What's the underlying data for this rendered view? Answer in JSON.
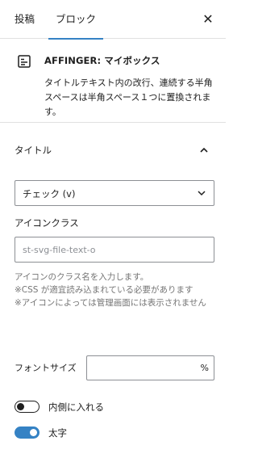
{
  "tabs": [
    {
      "label": "投稿",
      "active": false
    },
    {
      "label": "ブロック",
      "active": true
    }
  ],
  "block": {
    "icon": "card-icon",
    "title": "AFFINGER: マイボックス",
    "description": "タイトルテキスト内の改行、連続する半角スペースは半角スペース１つに置換されます。"
  },
  "panel": {
    "title": "タイトル",
    "expanded": true
  },
  "title_select": {
    "value": "チェック (v)"
  },
  "icon_class": {
    "label": "アイコンクラス",
    "placeholder": "st-svg-file-text-o",
    "value": "",
    "help": [
      "アイコンのクラス名を入力します。",
      "※CSS が適宜読み込まれている必要があります",
      "※アイコンによっては管理画面には表示されません"
    ]
  },
  "font_size": {
    "label": "フォントサイズ",
    "value": "",
    "unit": "%"
  },
  "toggles": [
    {
      "label": "内側に入れる",
      "on": false
    },
    {
      "label": "太字",
      "on": true
    }
  ],
  "colors": {
    "accent": "#3582c4",
    "border": "#e0e0e0",
    "input_border": "#8c8f94",
    "help_text": "#757575"
  }
}
